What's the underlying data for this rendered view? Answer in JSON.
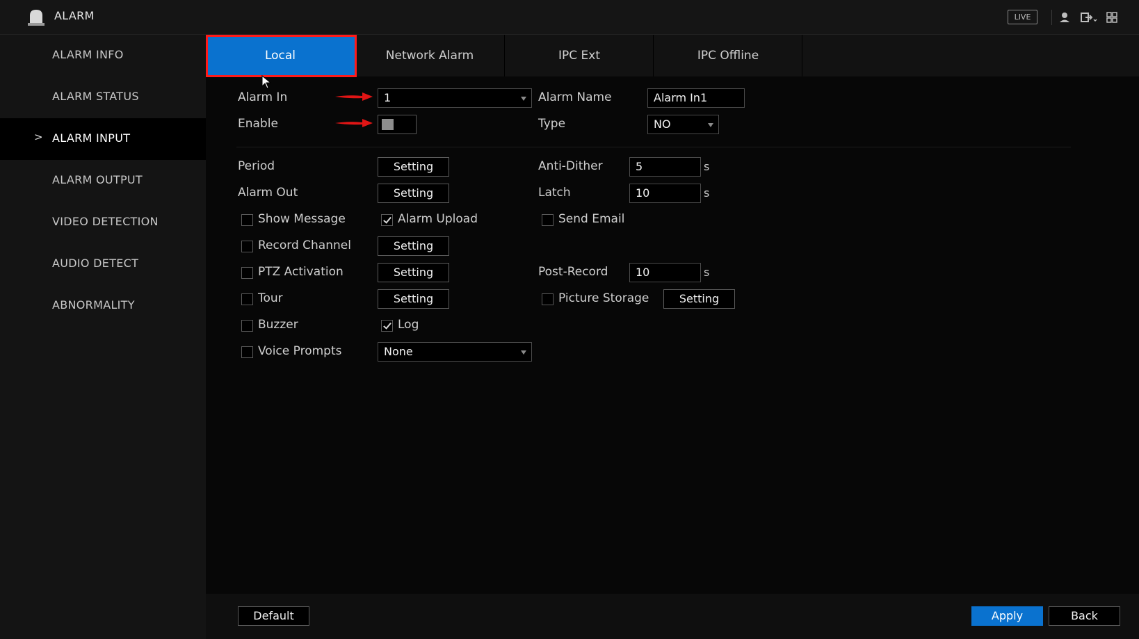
{
  "titlebar": {
    "title": "ALARM",
    "live_label": "LIVE",
    "icons": [
      "alarm-bell-icon",
      "user-icon",
      "logout-icon",
      "grid-menu-icon"
    ]
  },
  "sidebar": {
    "items": [
      {
        "label": "ALARM INFO",
        "active": false
      },
      {
        "label": "ALARM STATUS",
        "active": false
      },
      {
        "label": "ALARM INPUT",
        "active": true
      },
      {
        "label": "ALARM OUTPUT",
        "active": false
      },
      {
        "label": "VIDEO DETECTION",
        "active": false
      },
      {
        "label": "AUDIO DETECT",
        "active": false
      },
      {
        "label": "ABNORMALITY",
        "active": false
      }
    ],
    "chevron": ">"
  },
  "tabs": [
    {
      "label": "Local",
      "active": true
    },
    {
      "label": "Network Alarm",
      "active": false
    },
    {
      "label": "IPC Ext",
      "active": false
    },
    {
      "label": "IPC Offline",
      "active": false
    }
  ],
  "form": {
    "alarm_in": {
      "label": "Alarm In",
      "value": "1"
    },
    "alarm_name": {
      "label": "Alarm Name",
      "value": "Alarm In1"
    },
    "enable": {
      "label": "Enable",
      "on": false
    },
    "type": {
      "label": "Type",
      "value": "NO"
    },
    "period": {
      "label": "Period",
      "button": "Setting"
    },
    "anti_dither": {
      "label": "Anti-Dither",
      "value": "5",
      "unit": "s"
    },
    "alarm_out": {
      "label": "Alarm Out",
      "button": "Setting"
    },
    "latch": {
      "label": "Latch",
      "value": "10",
      "unit": "s"
    },
    "show_message": {
      "label": "Show Message",
      "checked": false
    },
    "alarm_upload": {
      "label": "Alarm Upload",
      "checked": true
    },
    "send_email": {
      "label": "Send Email",
      "checked": false
    },
    "record_channel": {
      "label": "Record Channel",
      "checked": false,
      "button": "Setting"
    },
    "ptz_activation": {
      "label": "PTZ Activation",
      "checked": false,
      "button": "Setting"
    },
    "post_record": {
      "label": "Post-Record",
      "value": "10",
      "unit": "s"
    },
    "tour": {
      "label": "Tour",
      "checked": false,
      "button": "Setting"
    },
    "picture_storage": {
      "label": "Picture Storage",
      "checked": false,
      "button": "Setting"
    },
    "buzzer": {
      "label": "Buzzer",
      "checked": false
    },
    "log": {
      "label": "Log",
      "checked": true
    },
    "voice_prompts": {
      "label": "Voice Prompts",
      "checked": false,
      "value": "None"
    }
  },
  "footer": {
    "default_label": "Default",
    "apply_label": "Apply",
    "back_label": "Back"
  },
  "colors": {
    "accent": "#0a72cf",
    "highlight": "#ff1a1a",
    "arrow": "#e01515"
  }
}
